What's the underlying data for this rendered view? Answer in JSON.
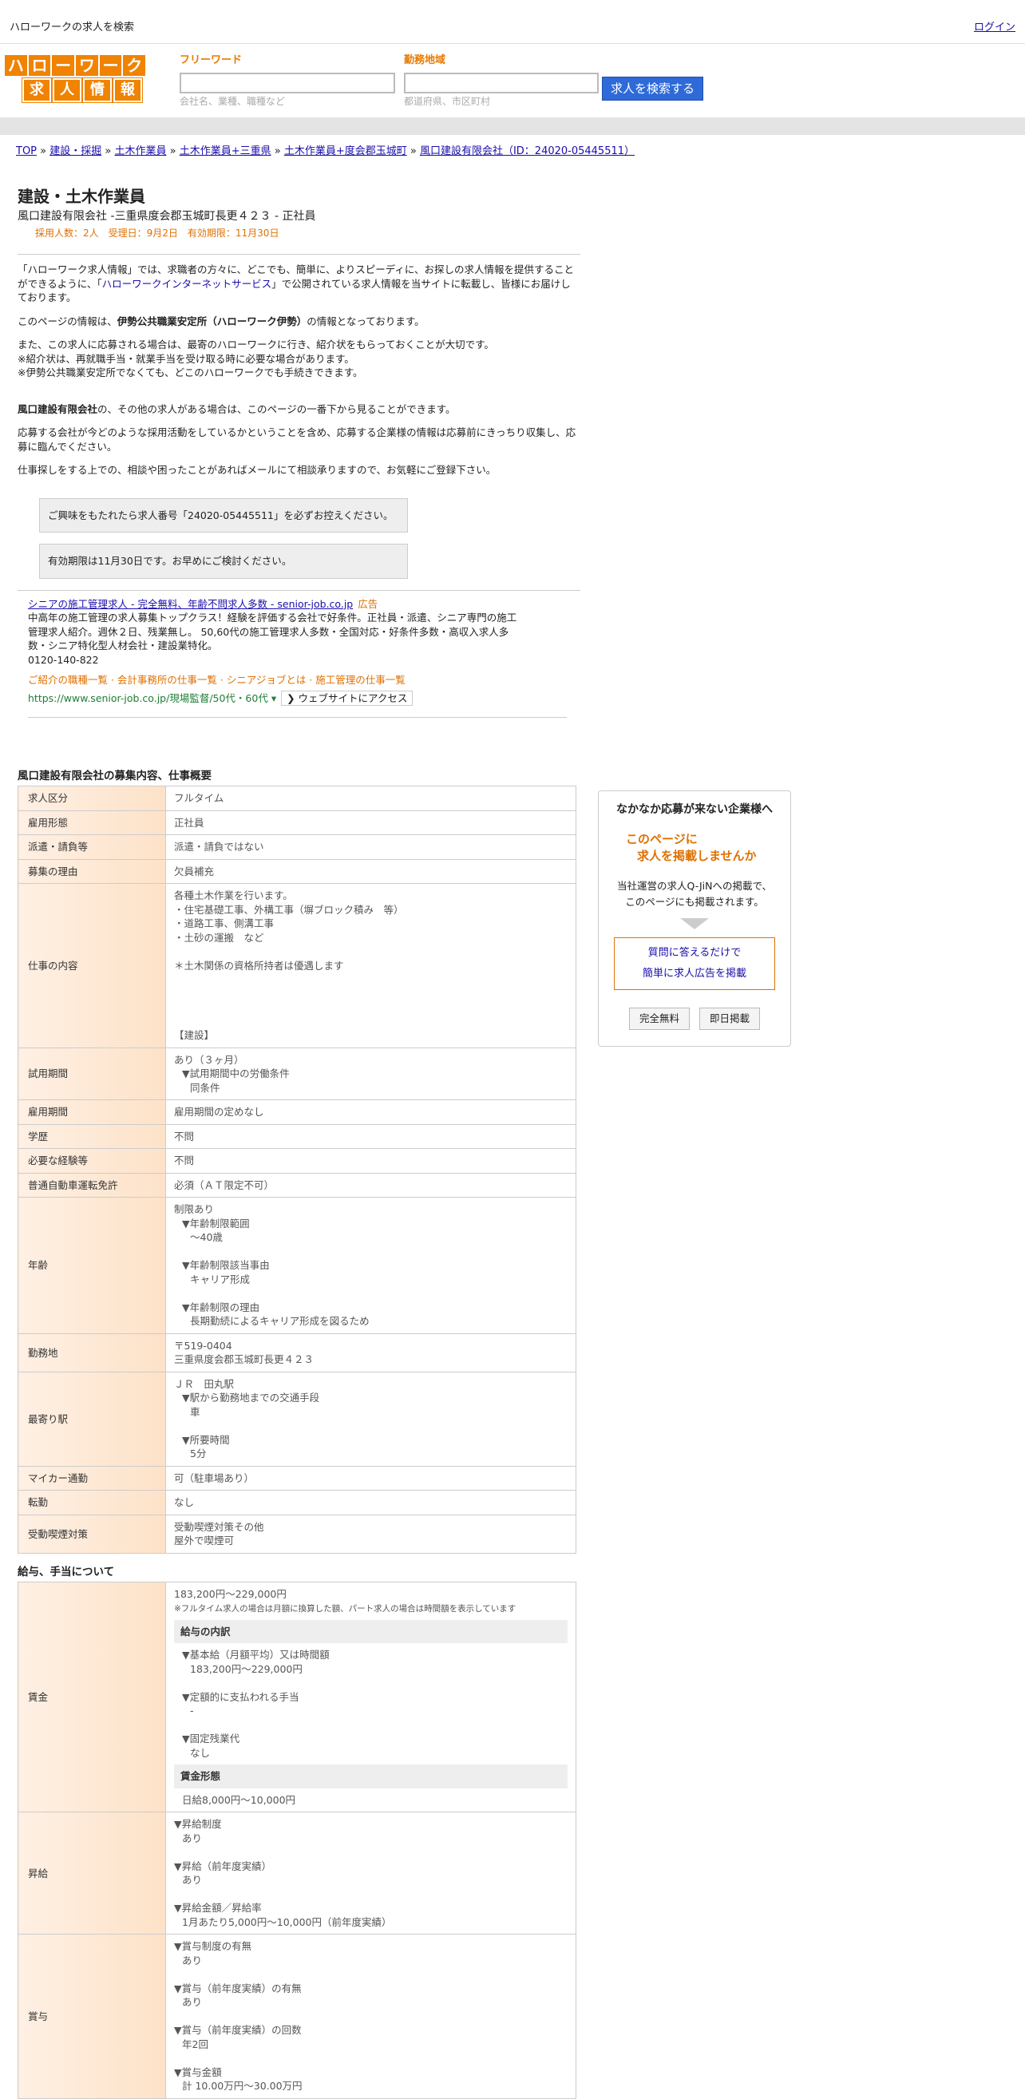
{
  "top": {
    "site_title": "ハローワークの求人を検索",
    "login": "ログイン"
  },
  "logo": {
    "row1": [
      "ハ",
      "ロ",
      "ー",
      "ワ",
      "ー",
      "ク"
    ],
    "row2": [
      "求",
      "人",
      "情",
      "報"
    ]
  },
  "search": {
    "freeword_label": "フリーワード",
    "freeword_placeholder": "会社名、業種、職種など",
    "area_label": "勤務地域",
    "area_placeholder": "都道府県、市区町村",
    "button": "求人を検索する"
  },
  "breadcrumb": [
    "TOP",
    "建設・採掘",
    "土木作業員",
    "土木作業員+三重県",
    "土木作業員+度会郡玉城町",
    "風口建設有限会社（ID：24020-05445511）"
  ],
  "job": {
    "title": "建設・土木作業員",
    "company_line": "風口建設有限会社 -三重県度会郡玉城町長更４２３ - 正社員",
    "meta": "採用人数：2人　受理日：9月2日　有効期限：11月30日"
  },
  "intro": {
    "p1_a": "「ハローワーク求人情報」では、求職者の方々に、どこでも、簡単に、よりスピーディに、お探しの求人情報を提供することができるように、「",
    "p1_link": "ハローワークインターネットサービス",
    "p1_b": "」で公開されている求人情報を当サイトに転載し、皆様にお届けしております。",
    "p2_a": "このページの情報は、",
    "p2_bold": "伊勢公共職業安定所（ハローワーク伊勢）",
    "p2_b": "の情報となっております。",
    "p3_1": "また、この求人に応募される場合は、最寄のハローワークに行き、紹介状をもらっておくことが大切です。",
    "p3_2": "※紹介状は、再就職手当・就業手当を受け取る時に必要な場合があります。",
    "p3_3": "※伊勢公共職業安定所でなくても、どこのハローワークでも手続きできます。",
    "p4_bold": "風口建設有限会社",
    "p4_rest": "の、その他の求人がある場合は、このページの一番下から見ることができます。",
    "p5": "応募する会社が今どのような採用活動をしているかということを含め、応募する企業様の情報は応募前にきっちり収集し、応募に臨んでください。",
    "p6": "仕事探しをする上での、相談や困ったことがあればメールにて相談承りますので、お気軽にご登録下さい。",
    "note1": "ご興味をもたれたら求人番号「24020-05445511」を必ずお控えください。",
    "note2": "有効期限は11月30日です。お早めにご検討ください。"
  },
  "ad": {
    "title": "シニアの施工管理求人 - 完全無料、年齢不問求人多数 - senior-job.co.jp",
    "tag": "広告",
    "body": "中高年の施工管理の求人募集トップクラス！経験を評価する会社で好条件。正社員・派遣、シニア専門の施工管理求人紹介。週休２日、残業無し。 50,60代の施工管理求人多数・全国対応・好条件多数・高収入求人多数・シニア特化型人材会社・建設業特化。",
    "phone": "0120-140-822",
    "links": "ご紹介の職種一覧 · 会計事務所の仕事一覧 · シニアジョブとは · 施工管理の仕事一覧",
    "url": "https://www.senior-job.co.jp/現場監督/50代・60代",
    "visit": "❯ ウェブサイトにアクセス"
  },
  "section1_title": "風口建設有限会社の募集内容、仕事概要",
  "section2_title": "給与、手当について",
  "sidebar": {
    "title": "なかなか応募が来ない企業様へ",
    "headline1": "このページに",
    "headline2": "求人を掲載しませんか",
    "desc1": "当社運営の求人Q-JiNへの掲載で、",
    "desc2": "このページにも掲載されます。",
    "link1": "質問に答えるだけで",
    "link2": "簡単に求人広告を掲載",
    "btn1": "完全無料",
    "btn2": "即日掲載"
  }
}
